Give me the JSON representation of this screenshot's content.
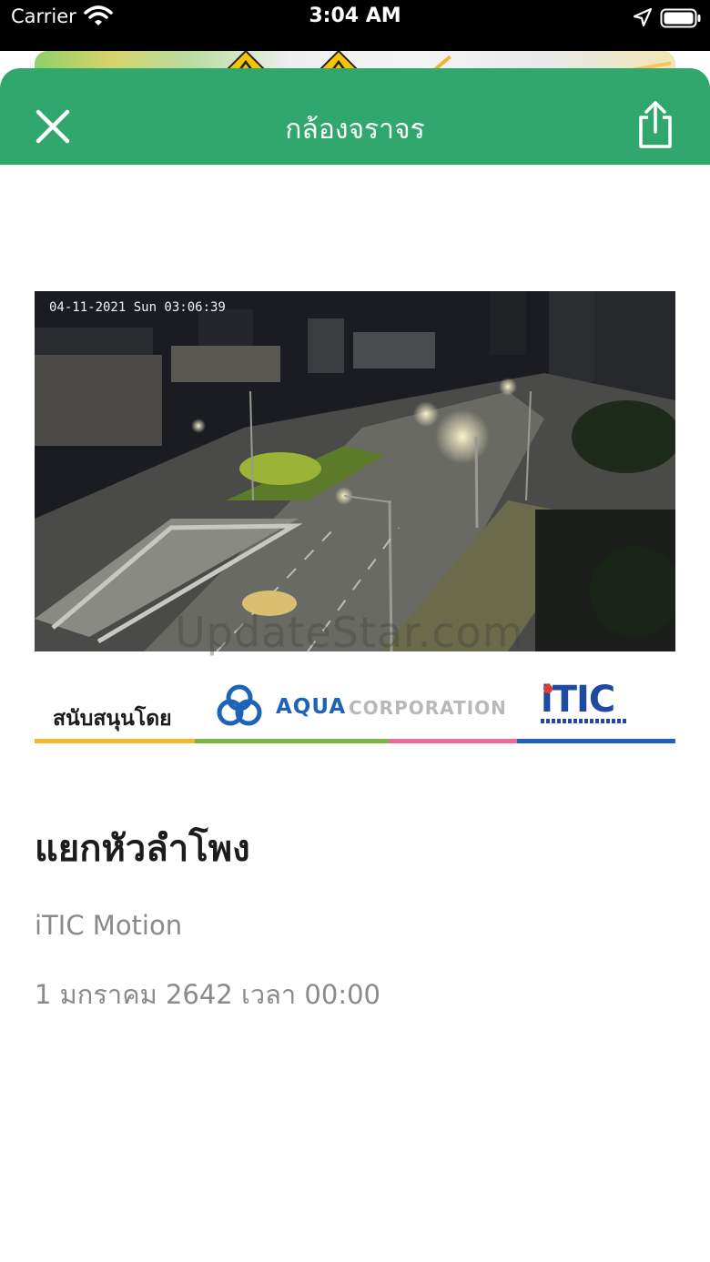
{
  "status_bar": {
    "carrier": "Carrier",
    "time": "3:04 AM"
  },
  "header": {
    "title": "กล้องจราจร",
    "background_color": "#30a76c"
  },
  "camera": {
    "timestamp": "04-11-2021 Sun 03:06:39",
    "watermark": "UpdateStar.com"
  },
  "sponsors": {
    "label": "สนับสนุนโดย",
    "aqua_name": "AQUA",
    "aqua_suffix": "CORPORATION",
    "itic_name": "iTIC",
    "stripe_colors": [
      "#f3b62e",
      "#7cb342",
      "#ec6a9c",
      "#1e63b8"
    ]
  },
  "info": {
    "location": "แยกหัวลำโพง",
    "source": "iTIC Motion",
    "datetime": "1 มกราคม 2642 เวลา 00:00"
  },
  "icons": {
    "close": "close-icon",
    "share": "share-icon",
    "wifi": "wifi-icon",
    "location": "location-arrow-icon",
    "battery": "battery-icon"
  }
}
